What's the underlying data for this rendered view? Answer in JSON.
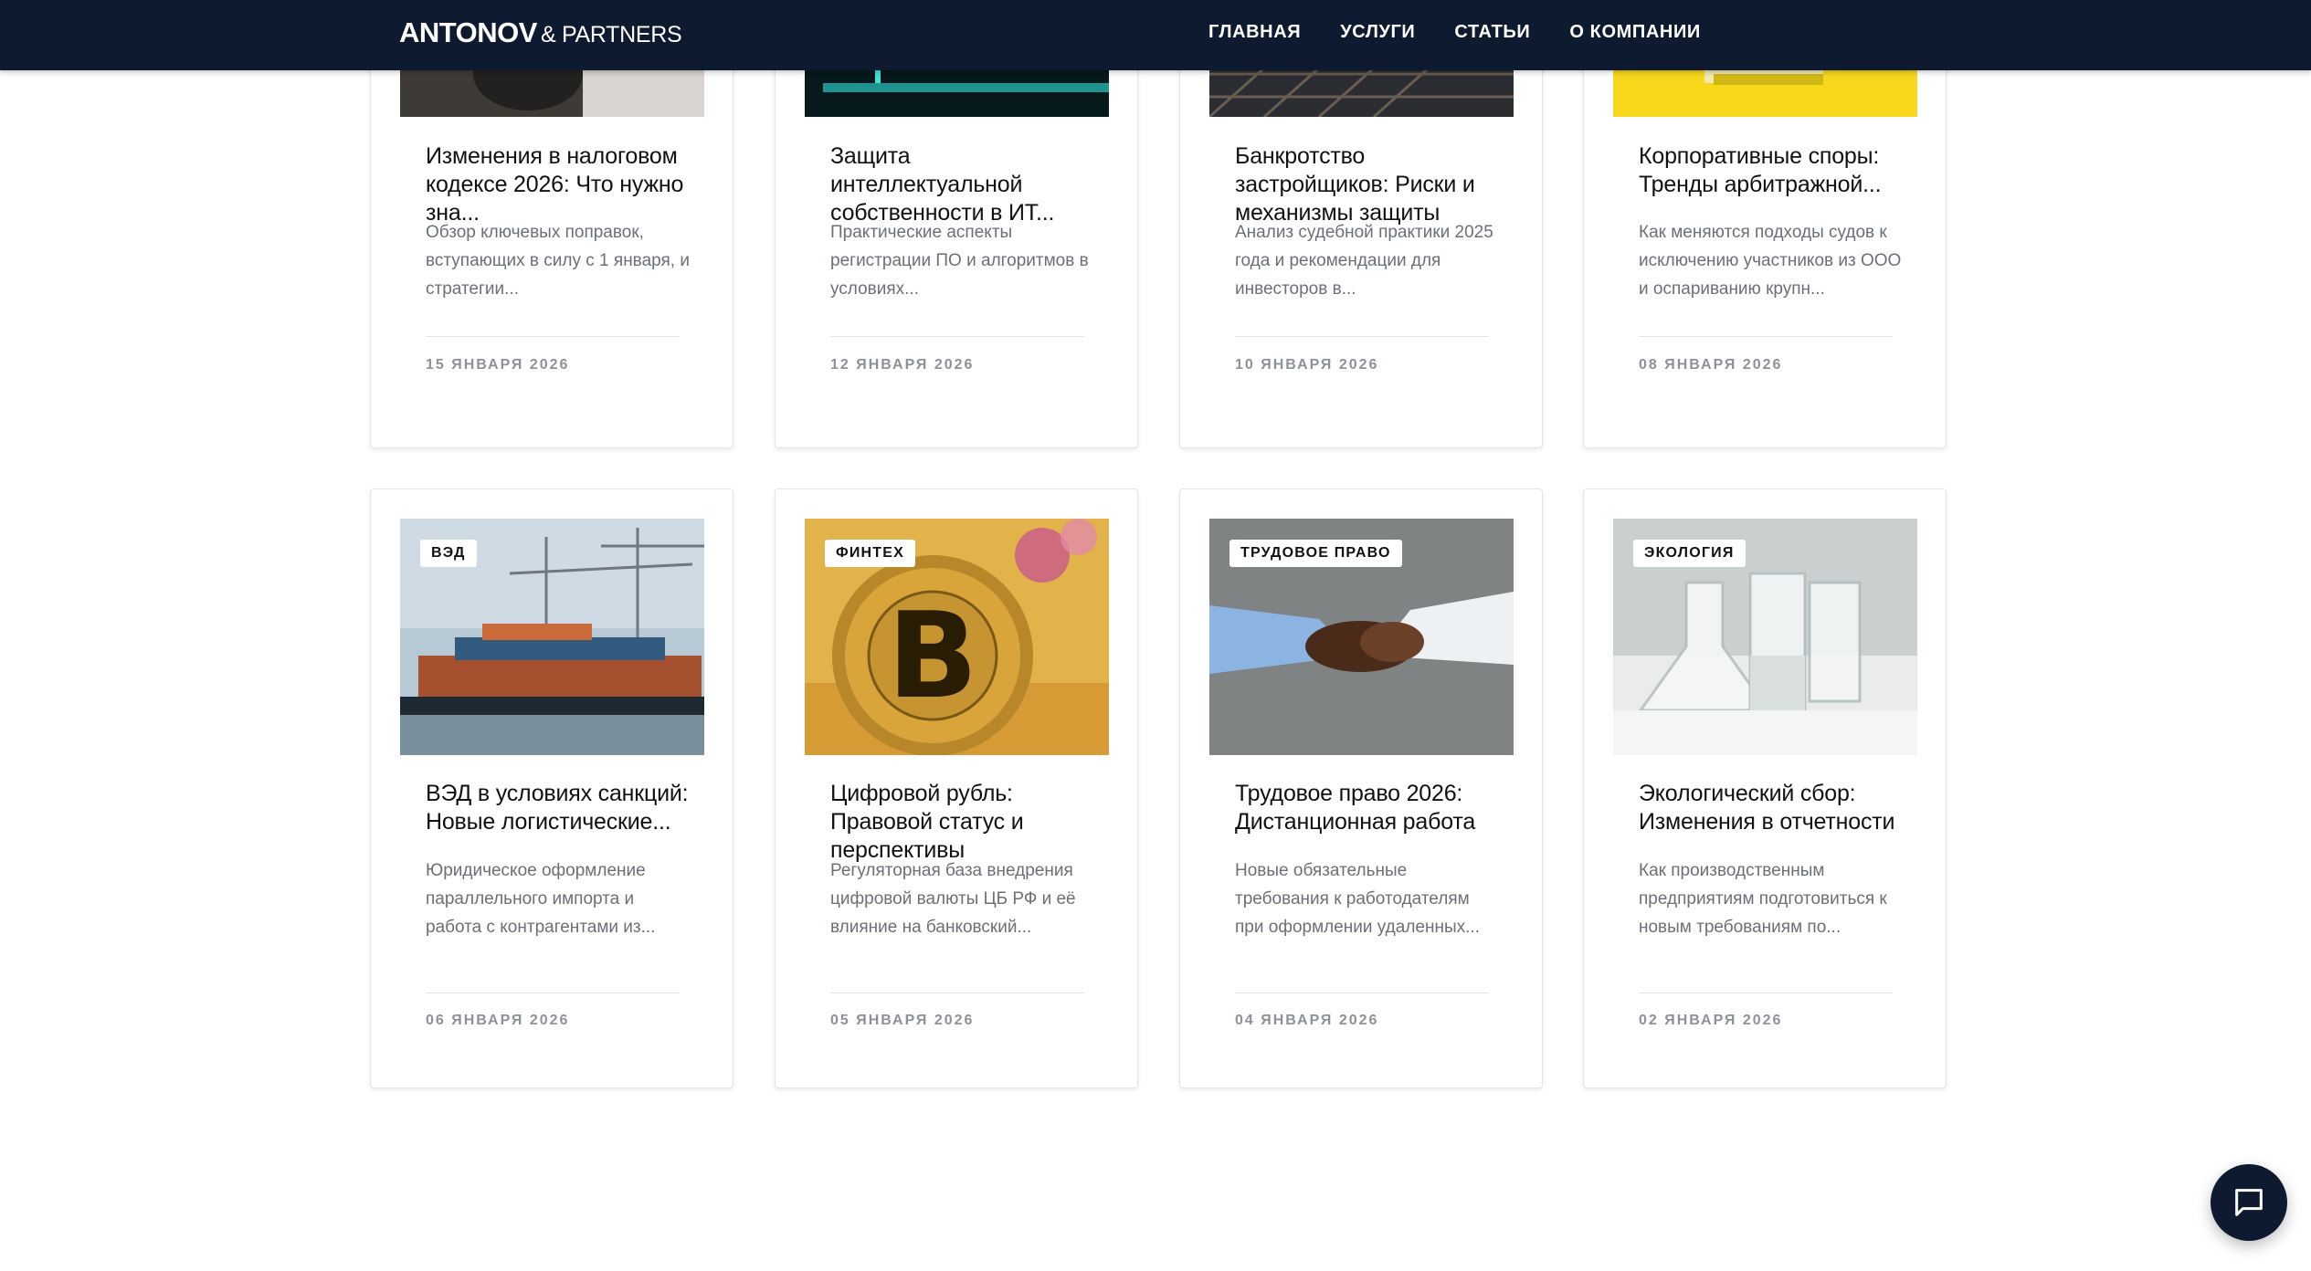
{
  "header": {
    "logo_main": "ANTONOV",
    "logo_sub": "& PARTNERS",
    "nav": [
      "ГЛАВНАЯ",
      "УСЛУГИ",
      "СТАТЬИ",
      "О КОМПАНИИ"
    ]
  },
  "articles": [
    {
      "tag": "",
      "title": "Изменения в налоговом кодексе 2026: Что нужно зна...",
      "excerpt": "Обзор ключевых поправок, вступающих в силу с 1 января, и стратегии...",
      "date": "15 ЯНВАРЯ 2026"
    },
    {
      "tag": "",
      "title": "Защита интеллектуальной собственности в ИТ...",
      "excerpt": "Практические аспекты регистрации ПО и алгоритмов в условиях...",
      "date": "12 ЯНВАРЯ 2026"
    },
    {
      "tag": "",
      "title": "Банкротство застройщиков: Риски и механизмы защиты",
      "excerpt": "Анализ судебной практики 2025 года и рекомендации для инвесторов в...",
      "date": "10 ЯНВАРЯ 2026"
    },
    {
      "tag": "",
      "title": "Корпоративные споры: Тренды арбитражной...",
      "excerpt": "Как меняются подходы судов к исключению участников из ООО и оспариванию крупн...",
      "date": "08 ЯНВАРЯ 2026"
    },
    {
      "tag": "ВЭД",
      "title": "ВЭД в условиях санкций: Новые логистические...",
      "excerpt": "Юридическое оформление параллельного импорта и работа с контрагентами из...",
      "date": "06 ЯНВАРЯ 2026"
    },
    {
      "tag": "ФИНТЕХ",
      "title": "Цифровой рубль: Правовой статус и перспективы",
      "excerpt": "Регуляторная база внедрения цифровой валюты ЦБ РФ и её влияние на банковский...",
      "date": "05 ЯНВАРЯ 2026"
    },
    {
      "tag": "ТРУДОВОЕ ПРАВО",
      "title": "Трудовое право 2026: Дистанционная работа",
      "excerpt": "Новые обязательные требования к работодателям при оформлении удаленных...",
      "date": "04 ЯНВАРЯ 2026"
    },
    {
      "tag": "ЭКОЛОГИЯ",
      "title": "Экологический сбор: Изменения в отчетности",
      "excerpt": "Как производственным предприятиям подготовиться к новым требованиям по...",
      "date": "02 ЯНВАРЯ 2026"
    }
  ],
  "icons": {
    "chat": "chat-bubble-icon"
  },
  "colors": {
    "header_bg": "#0d1a30",
    "tag_bg": "#ffffff",
    "meta_text": "#8d9198"
  }
}
